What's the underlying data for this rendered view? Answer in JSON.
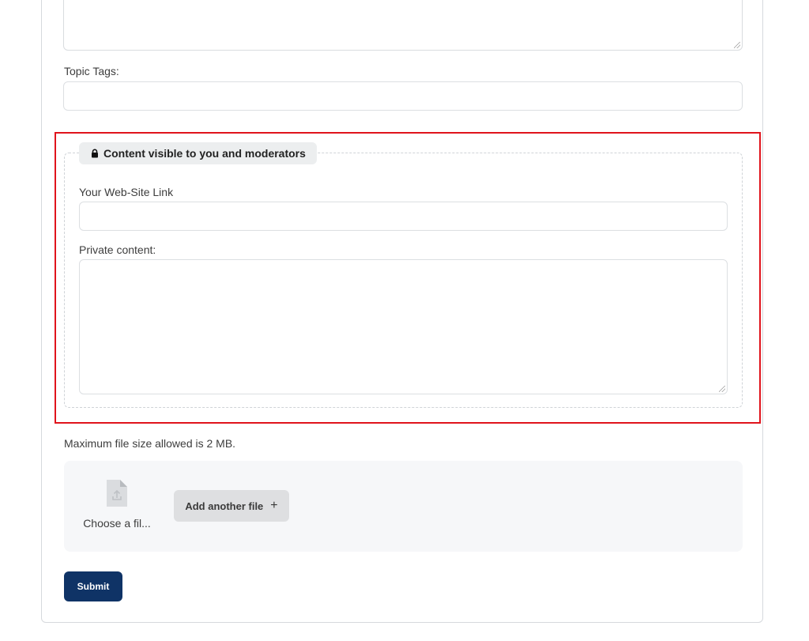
{
  "form": {
    "topic_tags_label": "Topic Tags:",
    "topic_tags_value": "",
    "private_section": {
      "legend": "Content visible to you and moderators",
      "website_label": "Your Web-Site Link",
      "website_value": "",
      "private_content_label": "Private content:",
      "private_content_value": ""
    },
    "max_file_size_text": "Maximum file size allowed is 2 MB.",
    "upload": {
      "file_name": "Choose a fil...",
      "add_another_label": "Add another file",
      "add_icon": "plus-icon",
      "file_icon": "file-upload-icon"
    },
    "submit_label": "Submit"
  },
  "colors": {
    "highlight": "#e0141c",
    "submit_bg": "#0f3366",
    "upload_bg": "#f6f7f9"
  }
}
